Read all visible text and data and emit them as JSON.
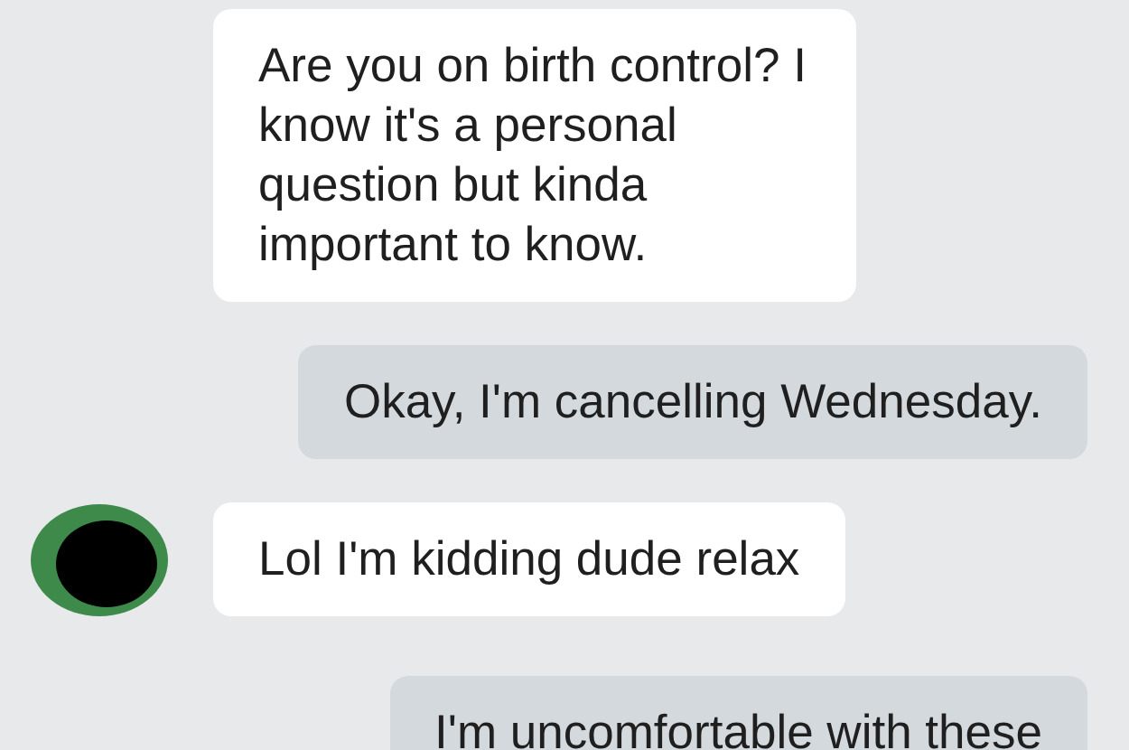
{
  "messages": [
    {
      "kind": "received",
      "text": "Are you on birth control? I know it's a personal question but kinda important to know.",
      "show_avatar": false
    },
    {
      "kind": "sent",
      "text": "Okay, I'm cancelling Wednesday.",
      "show_avatar": false
    },
    {
      "kind": "received",
      "text": "Lol I'm kidding dude relax",
      "show_avatar": true
    },
    {
      "kind": "sent",
      "text": "I'm uncomfortable with these",
      "show_avatar": false
    }
  ]
}
